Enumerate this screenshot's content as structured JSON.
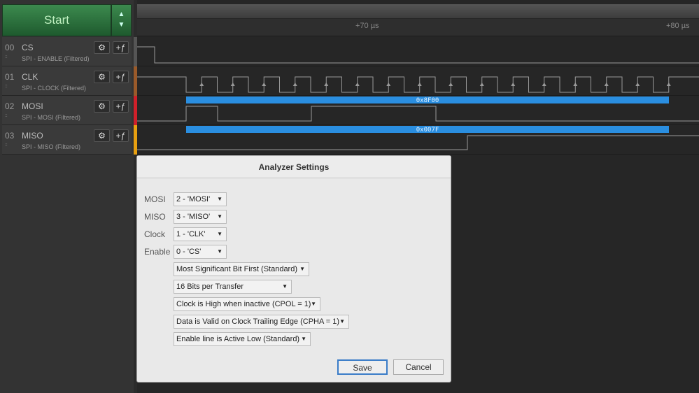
{
  "start_label": "Start",
  "ruler": {
    "t1": "+70 µs",
    "t2": "+80 µs"
  },
  "channels": [
    {
      "num": "00",
      "name": "CS",
      "sub": "SPI - ENABLE (Filtered)",
      "color": "#555555"
    },
    {
      "num": "01",
      "name": "CLK",
      "sub": "SPI - CLOCK (Filtered)",
      "color": "#9a5a2a"
    },
    {
      "num": "02",
      "name": "MOSI",
      "sub": "SPI - MOSI (Filtered)",
      "color": "#d0202a"
    },
    {
      "num": "03",
      "name": "MISO",
      "sub": "SPI - MISO (Filtered)",
      "color": "#e8a010"
    }
  ],
  "decoded": {
    "mosi": "0x8F00",
    "miso": "0x007F",
    "bar_color": "#2a8ee0"
  },
  "dialog": {
    "title": "Analyzer Settings",
    "fields": [
      {
        "label": "MOSI",
        "value": "2 - 'MOSI'"
      },
      {
        "label": "MISO",
        "value": "3 - 'MISO'"
      },
      {
        "label": "Clock",
        "value": "1 - 'CLK'"
      },
      {
        "label": "Enable",
        "value": "0 - 'CS'"
      }
    ],
    "options": [
      "Most Significant Bit First (Standard)",
      "16 Bits per Transfer",
      "Clock is High when inactive (CPOL = 1)",
      "Data is Valid on Clock Trailing Edge (CPHA = 1)",
      "Enable line is Active Low (Standard)"
    ],
    "save": "Save",
    "cancel": "Cancel"
  }
}
